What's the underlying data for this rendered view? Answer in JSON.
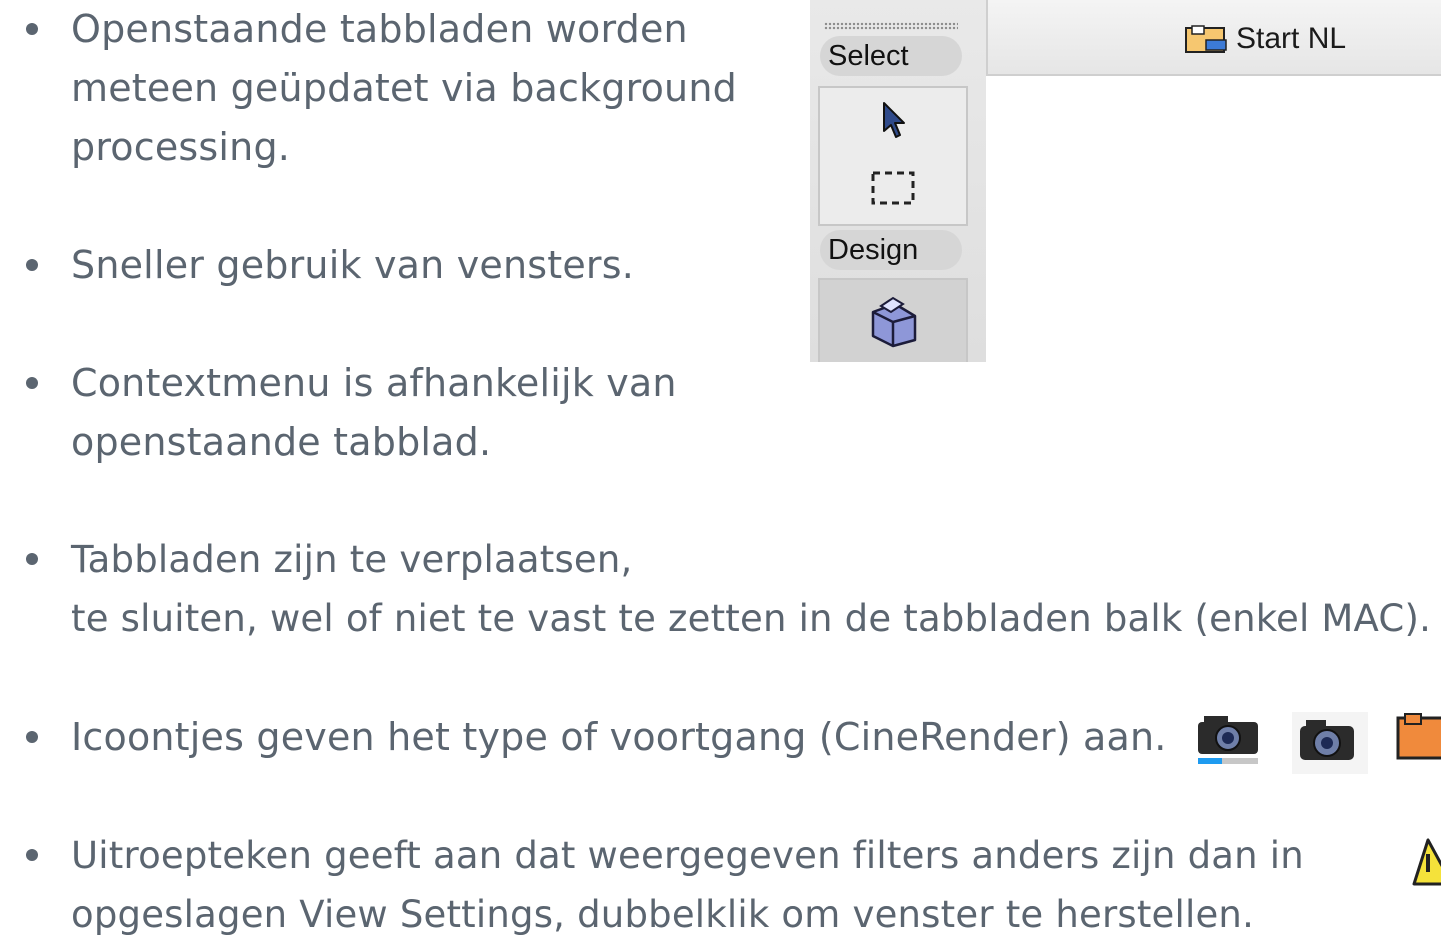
{
  "bullets": [
    {
      "lines": [
        "Openstaande tabbladen worden",
        "meteen geüpdatet via background",
        "processing."
      ]
    },
    {
      "lines": [
        "Sneller gebruik van vensters."
      ]
    },
    {
      "lines": [
        "Contextmenu is afhankelijk van",
        "openstaande tabblad."
      ]
    },
    {
      "lines": [
        "Tabbladen zijn te verplaatsen,",
        "te sluiten, wel of niet te vast te zetten in de tabbladen balk (enkel MAC)."
      ]
    },
    {
      "lines": [
        "Icoontjes geven het type of voortgang (CineRender) aan."
      ]
    },
    {
      "lines": [
        "Uitroepteken geeft aan dat weergegeven filters anders zijn dan in",
        "opgeslagen View Settings, dubbelklik om venster te herstellen."
      ]
    }
  ],
  "screenshot": {
    "palette": {
      "select_label": "Select",
      "design_label": "Design",
      "tools": [
        "arrow-tool",
        "marquee-tool",
        "wall-tool"
      ]
    },
    "tab": {
      "title": "Start NL",
      "icon": "folder-plan-icon"
    }
  },
  "status_icons": [
    "camera-progress-icon",
    "camera-icon",
    "orange-folder-icon",
    "warning-icon"
  ],
  "colors": {
    "text": "#5b6570",
    "progress": "#1e9bf0",
    "orange": "#f08a3c",
    "warning": "#f5e23a"
  }
}
